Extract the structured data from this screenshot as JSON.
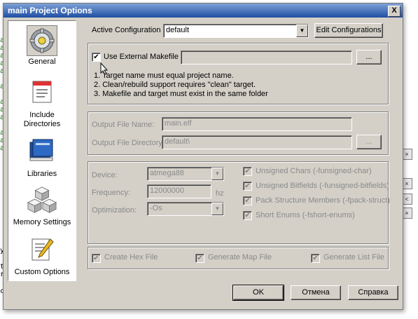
{
  "dialog": {
    "title": "main Project Options",
    "close_label": "X"
  },
  "sidebar": {
    "items": [
      {
        "label": "General",
        "icon": "gear-icon"
      },
      {
        "label": "Include\nDirectories",
        "icon": "folder-include-icon"
      },
      {
        "label": "Libraries",
        "icon": "books-icon"
      },
      {
        "label": "Memory Settings",
        "icon": "memory-cubes-icon"
      },
      {
        "label": "Custom Options",
        "icon": "notepad-pencil-icon"
      }
    ]
  },
  "active_config": {
    "label": "Active Configuration",
    "value": "default",
    "edit_button": "Edit Configurations"
  },
  "external_makefile": {
    "checkbox_label": "Use External Makefile",
    "checked": true,
    "path": "",
    "browse_label": "...",
    "notes": [
      "1. Target name must equal project name.",
      "2. Clean/rebuild support requires  \"clean\" target.",
      "3. Makefile and target must exist in the same folder"
    ]
  },
  "output": {
    "file_name_label": "Output File Name:",
    "file_name": "main.elf",
    "directory_label": "Output File Directory:",
    "directory": "default\\",
    "browse_label": "..."
  },
  "device_settings": {
    "device_label": "Device:",
    "device": "atmega88",
    "frequency_label": "Frequency:",
    "frequency": "12000000",
    "frequency_unit": "hz",
    "optimization_label": "Optimization:",
    "optimization": "-Os",
    "options": [
      {
        "label": "Unsigned Chars (-funsigned-char)",
        "checked": true
      },
      {
        "label": "Unsigned Bitfields (-funsigned-bitfields)",
        "checked": true
      },
      {
        "label": "Pack Structure Members (-fpack-struct)",
        "checked": true
      },
      {
        "label": "Short Enums (-fshort-enums)",
        "checked": true
      }
    ]
  },
  "generate": {
    "hex": "Create Hex File",
    "map": "Generate Map File",
    "list": "Generate List File"
  },
  "footer": {
    "ok": "OK",
    "cancel": "Отмена",
    "help": "Справка"
  },
  "background": {
    "left_chars": [
      "a",
      "a",
      "a",
      "a",
      "a",
      "a",
      "a",
      "a",
      "a",
      "a",
      "a",
      "a",
      "a",
      "a",
      "a",
      "a",
      "y",
      "t",
      "r",
      "c"
    ],
    "right_marks": [
      "×",
      "×",
      "<",
      "×"
    ]
  }
}
